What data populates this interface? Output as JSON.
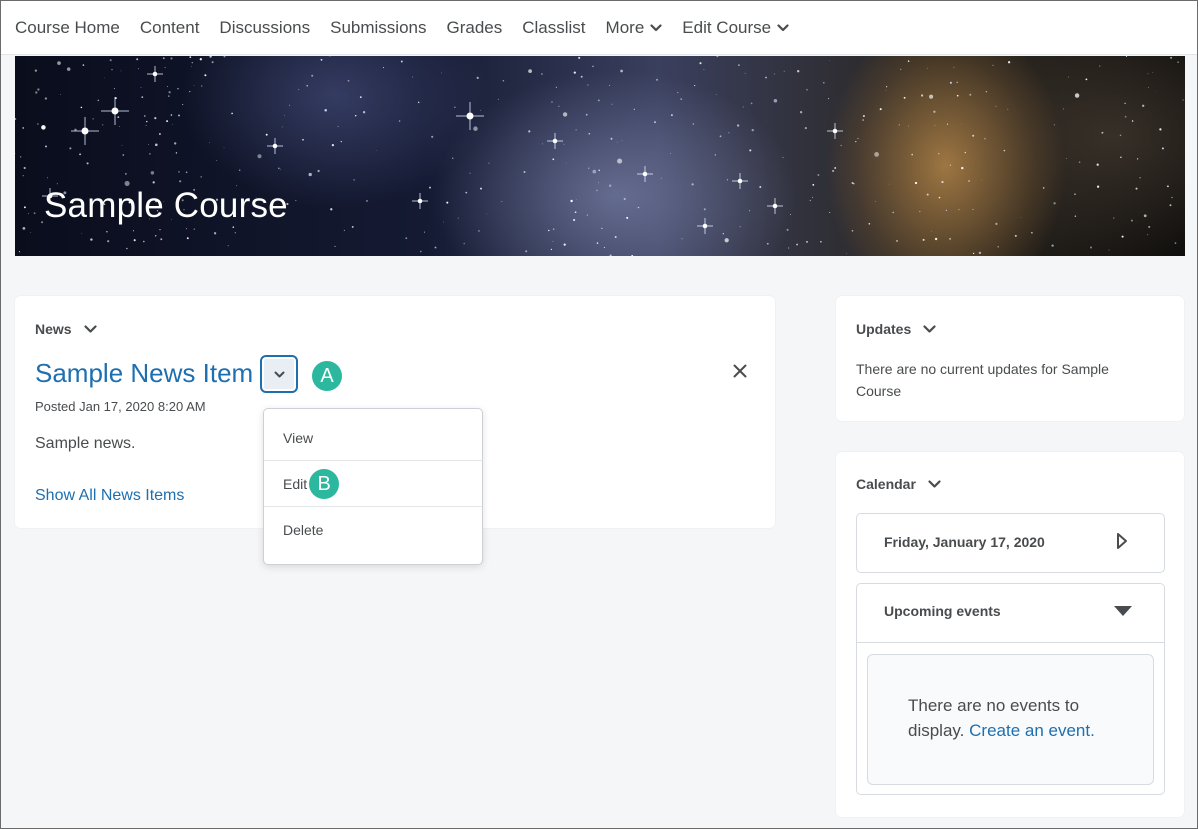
{
  "nav": {
    "items": [
      {
        "label": "Course Home"
      },
      {
        "label": "Content"
      },
      {
        "label": "Discussions"
      },
      {
        "label": "Submissions"
      },
      {
        "label": "Grades"
      },
      {
        "label": "Classlist"
      },
      {
        "label": "More",
        "dropdown": true
      },
      {
        "label": "Edit Course",
        "dropdown": true
      }
    ]
  },
  "banner": {
    "course_title": "Sample Course"
  },
  "news": {
    "widget_title": "News",
    "item_title": "Sample News Item",
    "posted": "Posted Jan 17, 2020 8:20 AM",
    "body": "Sample news.",
    "show_all": "Show All News Items",
    "badge_a": "A",
    "menu": {
      "items": [
        "View",
        "Edit",
        "Delete"
      ],
      "badge_b": "B"
    }
  },
  "updates": {
    "widget_title": "Updates",
    "message": "There are no current updates for Sample Course"
  },
  "calendar": {
    "widget_title": "Calendar",
    "date": "Friday, January 17, 2020",
    "upcoming_label": "Upcoming events",
    "empty_message": "There are no events to display.",
    "create_link": "Create an event."
  },
  "colors": {
    "link": "#1e6fb0",
    "badge": "#2bb89e",
    "text": "#494c4e"
  }
}
